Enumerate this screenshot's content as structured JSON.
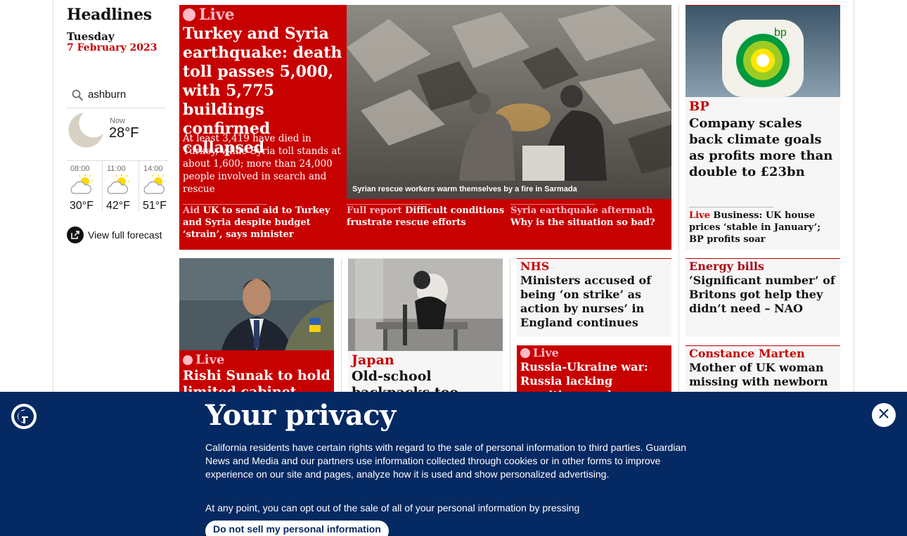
{
  "left": {
    "section_title": "Headlines",
    "day": "Tuesday",
    "date": "7 February 2023",
    "location": "ashburn",
    "now_label": "Now",
    "now_temp": "28°F",
    "now_icon": "moon-icon",
    "forecast": [
      {
        "time": "08:00",
        "temp": "30°F",
        "icon": "sun-cloud-icon"
      },
      {
        "time": "11:00",
        "temp": "42°F",
        "icon": "sun-cloud-icon"
      },
      {
        "time": "14:00",
        "temp": "51°F",
        "icon": "sun-cloud-icon"
      }
    ],
    "full_forecast": "View full forecast"
  },
  "main": {
    "live": "Live",
    "headline": "Turkey and Syria earthquake: death toll passes 5,000, with 5,775 buildings confirmed collapsed",
    "standfirst": "At least 3,419 have died in Turkey, while Syria toll stands at about 1,600; more than 24,000 people involved in search and rescue",
    "caption": "Syrian rescue workers warm themselves by a fire in Sarmada",
    "subs": [
      {
        "kicker": "Aid",
        "text": " UK to send aid to Turkey and Syria despite budget ‘strain’, says minister"
      },
      {
        "kicker": "Full report",
        "text": " Difficult conditions frustrate rescue efforts"
      },
      {
        "kicker": "Syria earthquake aftermath",
        "text": " Why is the situation so bad?"
      }
    ]
  },
  "bp": {
    "kicker": "BP",
    "headline": "Company scales back climate goals as profits more than double to £23bn",
    "sub_kicker": "Live",
    "sub_text": " Business: UK house prices ‘stable in January’; BP profits soar",
    "logo_text": "bp"
  },
  "sunak": {
    "live": "Live",
    "headline": "Rishi Sunak to hold limited cabinet shuffle"
  },
  "japan": {
    "kicker": "Japan",
    "headline": "Old-school backpacks too heavy, pupils"
  },
  "nhs": {
    "kicker": "NHS",
    "headline": "Ministers accused of being ‘on strike’ as action by nurses’ in England continues"
  },
  "energy": {
    "kicker": "Energy bills",
    "headline": "‘Significant number’ of Britons got help they didn’t need – NAO"
  },
  "ukraine": {
    "live": "Live",
    "headline": "Russia-Ukraine war: Russia lacking munitions and"
  },
  "marten": {
    "kicker": "Constance Marten",
    "headline": "Mother of UK woman missing with newborn"
  },
  "privacy": {
    "title": "Your privacy",
    "body": "California residents have certain rights with regard to the sale of personal information to third parties. Guardian News and Media and our partners use information collected through cookies or in other forms to improve experience on our site and pages, analyze how it is used and show personalized advertising.",
    "body2": "At any point, you can opt out of the sale of all of your personal information by pressing",
    "button": "Do not sell my personal information"
  },
  "colors": {
    "news_red": "#c70000",
    "live_pink": "#ffbac8",
    "guardian_blue": "#052962",
    "card_grey": "#f6f6f6"
  }
}
